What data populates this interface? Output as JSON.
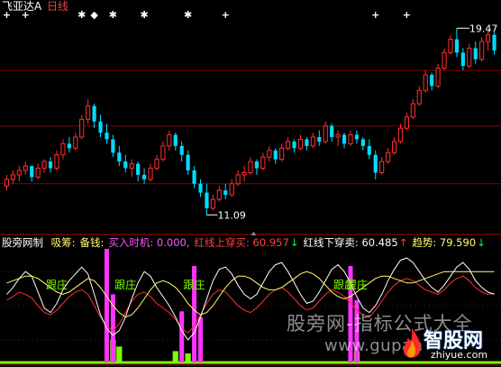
{
  "header": {
    "stock_name": "飞亚达A",
    "period": "日线",
    "colors": {
      "stock_name": "#ffffff",
      "period": "#ff3b3b"
    }
  },
  "indicator": {
    "name": "股旁网制",
    "params": [
      {
        "text": "吸筹:",
        "color": "#ffff66"
      },
      {
        "text": "备钱:",
        "color": "#ffff66"
      },
      {
        "text": "买入时机: 0.000,",
        "color": "#ff55ff"
      },
      {
        "text": "红线上穿买: 60.957",
        "color": "#ff4040"
      },
      {
        "text": "↓",
        "color": "#00ff66"
      },
      {
        "text": "红线下穿卖: 60.485",
        "color": "#ffffff"
      },
      {
        "text": "↑",
        "color": "#ff4040"
      },
      {
        "text": "趋势: 79.590",
        "color": "#ffff66"
      },
      {
        "text": "↓",
        "color": "#00ff66"
      }
    ],
    "gen_zhuang_label": "跟庄",
    "gen_zhuang_color": "#7CFC00"
  },
  "watermark": {
    "cn": "股旁网-指标公式大全",
    "url": "www.gupan",
    "logo_text": "智股网",
    "logo_url": "zhiyue.com"
  },
  "chart_data": [
    {
      "type": "candlestick",
      "title": "",
      "high_label": "19.47",
      "low_label": "11.09",
      "ylim": [
        10.3,
        20.2
      ],
      "gridlines": [
        12.5,
        15.1,
        17.6
      ],
      "colors": {
        "up": "#ff3030",
        "down": "#00dcff",
        "grid": "#8b0000"
      },
      "markers": {
        "symbols": [
          "+",
          "✱",
          "◆"
        ],
        "color": "#ffffff"
      },
      "candles": [
        [
          12.4,
          12.9,
          12.2,
          12.7
        ],
        [
          12.7,
          13.1,
          12.5,
          12.9
        ],
        [
          12.9,
          13.3,
          12.6,
          13.1
        ],
        [
          13.1,
          13.5,
          12.9,
          13.3
        ],
        [
          13.3,
          13.2,
          12.6,
          12.8
        ],
        [
          12.8,
          13.4,
          12.7,
          13.2
        ],
        [
          13.2,
          13.6,
          13.0,
          13.5
        ],
        [
          13.5,
          13.7,
          13.0,
          13.2
        ],
        [
          13.2,
          14.0,
          13.1,
          13.8
        ],
        [
          13.8,
          14.5,
          13.6,
          14.3
        ],
        [
          14.3,
          14.6,
          13.9,
          14.1
        ],
        [
          14.1,
          14.8,
          14.0,
          14.6
        ],
        [
          14.6,
          15.6,
          14.5,
          15.4
        ],
        [
          15.4,
          16.3,
          15.2,
          16.0
        ],
        [
          16.0,
          16.1,
          15.0,
          15.3
        ],
        [
          15.3,
          15.6,
          14.6,
          14.8
        ],
        [
          14.8,
          15.2,
          14.3,
          14.5
        ],
        [
          14.5,
          14.7,
          13.7,
          13.9
        ],
        [
          13.9,
          14.2,
          13.3,
          13.5
        ],
        [
          13.5,
          13.8,
          13.0,
          13.2
        ],
        [
          13.2,
          13.6,
          12.8,
          13.4
        ],
        [
          13.4,
          13.5,
          12.6,
          12.9
        ],
        [
          12.9,
          13.2,
          12.5,
          12.7
        ],
        [
          12.7,
          13.4,
          12.6,
          13.2
        ],
        [
          13.2,
          13.8,
          13.1,
          13.6
        ],
        [
          13.6,
          14.4,
          13.5,
          14.2
        ],
        [
          14.2,
          14.9,
          14.0,
          14.7
        ],
        [
          14.7,
          14.8,
          14.0,
          14.2
        ],
        [
          14.2,
          14.4,
          13.5,
          13.8
        ],
        [
          13.8,
          14.0,
          12.9,
          13.1
        ],
        [
          13.1,
          13.3,
          12.3,
          12.5
        ],
        [
          12.5,
          12.7,
          11.9,
          12.1
        ],
        [
          12.1,
          12.5,
          11.1,
          11.4
        ],
        [
          11.4,
          12.0,
          11.3,
          11.8
        ],
        [
          11.8,
          12.4,
          11.7,
          12.2
        ],
        [
          12.2,
          12.5,
          11.8,
          12.0
        ],
        [
          12.0,
          12.7,
          11.9,
          12.5
        ],
        [
          12.5,
          13.1,
          12.4,
          12.9
        ],
        [
          12.9,
          13.3,
          12.6,
          13.0
        ],
        [
          13.0,
          13.7,
          12.9,
          13.5
        ],
        [
          13.5,
          13.6,
          12.9,
          13.2
        ],
        [
          13.2,
          13.9,
          13.1,
          13.7
        ],
        [
          13.7,
          14.2,
          13.5,
          14.0
        ],
        [
          14.0,
          14.1,
          13.4,
          13.6
        ],
        [
          13.6,
          14.3,
          13.5,
          14.1
        ],
        [
          14.1,
          14.6,
          14.0,
          14.4
        ],
        [
          14.4,
          14.5,
          13.9,
          14.1
        ],
        [
          14.1,
          14.7,
          14.0,
          14.5
        ],
        [
          14.5,
          14.6,
          14.0,
          14.2
        ],
        [
          14.2,
          14.8,
          14.1,
          14.6
        ],
        [
          14.6,
          14.9,
          14.2,
          14.4
        ],
        [
          14.4,
          15.3,
          14.3,
          15.1
        ],
        [
          15.1,
          15.2,
          14.4,
          14.6
        ],
        [
          14.6,
          14.9,
          14.2,
          14.7
        ],
        [
          14.7,
          14.8,
          14.1,
          14.3
        ],
        [
          14.3,
          14.9,
          14.2,
          14.7
        ],
        [
          14.7,
          14.9,
          14.3,
          14.5
        ],
        [
          14.5,
          14.6,
          14.0,
          14.2
        ],
        [
          14.2,
          14.5,
          13.6,
          13.8
        ],
        [
          13.8,
          14.0,
          12.7,
          13.0
        ],
        [
          13.0,
          13.7,
          12.9,
          13.5
        ],
        [
          13.5,
          14.1,
          13.4,
          13.9
        ],
        [
          13.9,
          14.6,
          13.8,
          14.4
        ],
        [
          14.4,
          15.2,
          14.3,
          15.0
        ],
        [
          15.0,
          15.7,
          14.9,
          15.5
        ],
        [
          15.5,
          16.3,
          15.4,
          16.1
        ],
        [
          16.1,
          16.9,
          16.0,
          16.7
        ],
        [
          16.7,
          17.6,
          16.6,
          17.4
        ],
        [
          17.4,
          17.5,
          16.7,
          16.9
        ],
        [
          16.9,
          17.9,
          16.8,
          17.7
        ],
        [
          17.7,
          18.6,
          17.6,
          18.4
        ],
        [
          18.4,
          19.2,
          18.3,
          19.0
        ],
        [
          19.0,
          19.5,
          18.2,
          18.4
        ],
        [
          18.4,
          18.6,
          17.6,
          17.8
        ],
        [
          17.8,
          18.8,
          17.7,
          18.6
        ],
        [
          18.6,
          18.9,
          17.9,
          18.1
        ],
        [
          18.1,
          19.1,
          18.0,
          18.9
        ],
        [
          18.9,
          19.4,
          18.5,
          19.2
        ],
        [
          19.2,
          19.3,
          18.3,
          18.5
        ]
      ],
      "marker_candles": [
        {
          "index": 0,
          "symbol": "+"
        },
        {
          "index": 3,
          "symbol": "+"
        },
        {
          "index": 12,
          "symbol": "✱"
        },
        {
          "index": 14,
          "symbol": "◆"
        },
        {
          "index": 17,
          "symbol": "✱"
        },
        {
          "index": 22,
          "symbol": "✱"
        },
        {
          "index": 29,
          "symbol": "✱"
        },
        {
          "index": 35,
          "symbol": "+"
        },
        {
          "index": 59,
          "symbol": "+"
        },
        {
          "index": 64,
          "symbol": "+"
        }
      ]
    },
    {
      "type": "line",
      "title": "股旁网制",
      "ylim": [
        0,
        100
      ],
      "gridlines": [
        20,
        50,
        80
      ],
      "series": [
        {
          "name": "红线上穿买",
          "color": "#ff3030",
          "values": [
            55,
            58,
            62,
            60,
            57,
            50,
            44,
            42,
            46,
            52,
            58,
            62,
            64,
            60,
            50,
            40,
            32,
            28,
            34,
            44,
            54,
            60,
            62,
            58,
            52,
            48,
            44,
            38,
            30,
            26,
            32,
            42,
            52,
            60,
            64,
            62,
            56,
            50,
            46,
            44,
            48,
            54,
            60,
            64,
            66,
            62,
            56,
            50,
            46,
            48,
            54,
            60,
            64,
            62,
            58,
            52,
            46,
            42,
            40,
            46,
            54,
            62,
            68,
            72,
            74,
            72,
            68,
            64,
            62,
            60,
            64,
            70,
            74,
            76,
            72,
            66,
            62,
            60,
            61
          ]
        },
        {
          "name": "红线下穿卖",
          "color": "#ffffff",
          "values": [
            60,
            66,
            74,
            80,
            76,
            62,
            48,
            44,
            52,
            64,
            72,
            78,
            84,
            78,
            60,
            42,
            30,
            24,
            28,
            40,
            56,
            70,
            80,
            76,
            66,
            58,
            50,
            40,
            28,
            20,
            26,
            40,
            56,
            72,
            82,
            84,
            78,
            68,
            60,
            56,
            60,
            70,
            80,
            86,
            88,
            80,
            70,
            60,
            52,
            54,
            62,
            72,
            82,
            86,
            80,
            70,
            58,
            48,
            44,
            50,
            60,
            72,
            82,
            90,
            92,
            88,
            80,
            72,
            66,
            62,
            68,
            76,
            84,
            88,
            82,
            72,
            66,
            62,
            60
          ]
        },
        {
          "name": "趋势",
          "color": "#ffff66",
          "values": [
            70,
            72,
            74,
            76,
            76,
            74,
            70,
            66,
            62,
            60,
            62,
            66,
            70,
            74,
            72,
            66,
            58,
            50,
            44,
            40,
            42,
            48,
            56,
            64,
            70,
            72,
            70,
            66,
            60,
            52,
            46,
            42,
            44,
            50,
            58,
            66,
            72,
            76,
            76,
            74,
            70,
            66,
            64,
            64,
            66,
            70,
            74,
            78,
            80,
            78,
            74,
            68,
            62,
            58,
            56,
            58,
            62,
            66,
            70,
            74,
            76,
            76,
            74,
            72,
            70,
            70,
            72,
            74,
            76,
            78,
            80,
            80,
            80,
            80,
            80,
            80,
            80,
            80,
            80
          ]
        }
      ],
      "signal_bars": [
        {
          "index": 16,
          "value": 100,
          "color": "#ff33ff"
        },
        {
          "index": 17,
          "value": 60,
          "color": "#ff33ff"
        },
        {
          "index": 28,
          "value": 45,
          "color": "#ff33ff"
        },
        {
          "index": 30,
          "value": 85,
          "color": "#ff33ff"
        },
        {
          "index": 31,
          "value": 40,
          "color": "#ff33ff"
        },
        {
          "index": 55,
          "value": 85,
          "color": "#ff33ff"
        },
        {
          "index": 56,
          "value": 55,
          "color": "#ff33ff"
        }
      ],
      "gen_zhuang_indices": [
        8,
        19,
        30,
        54,
        56
      ],
      "base_bars": [
        {
          "index": 17,
          "value": 20,
          "color": "#7CFC00"
        },
        {
          "index": 18,
          "value": 14,
          "color": "#7CFC00"
        },
        {
          "index": 27,
          "value": 10,
          "color": "#7CFC00"
        },
        {
          "index": 29,
          "value": 8,
          "color": "#7CFC00"
        },
        {
          "index": 56,
          "value": 10,
          "color": "#7CFC00"
        }
      ]
    }
  ]
}
